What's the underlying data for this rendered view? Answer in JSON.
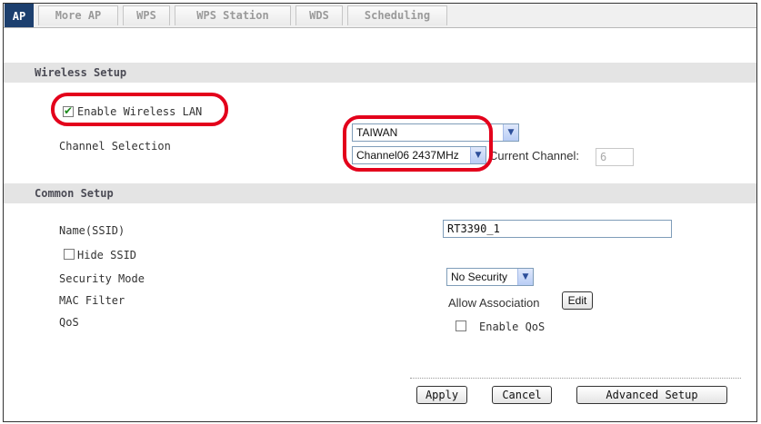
{
  "tabs": [
    {
      "label": "AP",
      "active": true
    },
    {
      "label": "More AP",
      "active": false
    },
    {
      "label": "WPS",
      "active": false
    },
    {
      "label": "WPS Station",
      "active": false
    },
    {
      "label": "WDS",
      "active": false
    },
    {
      "label": "Scheduling",
      "active": false
    }
  ],
  "wireless_setup": {
    "header": "Wireless Setup",
    "enable_wireless_label": "Enable Wireless LAN",
    "enable_wireless_checked": true,
    "channel_selection_label": "Channel Selection",
    "region_value": "TAIWAN",
    "channel_value": "Channel06 2437MHz",
    "current_channel_label": "Current Channel:",
    "current_channel_value": "6"
  },
  "common_setup": {
    "header": "Common Setup",
    "ssid_label": "Name(SSID)",
    "ssid_value": "RT3390_1",
    "hide_ssid_label": "Hide SSID",
    "hide_ssid_checked": false,
    "security_mode_label": "Security Mode",
    "security_mode_value": "No Security",
    "mac_filter_label": "MAC Filter",
    "mac_filter_value": "Allow Association",
    "edit_label": "Edit",
    "qos_label": "QoS",
    "enable_qos_label": "Enable QoS",
    "enable_qos_checked": false
  },
  "actions": {
    "apply_label": "Apply",
    "cancel_label": "Cancel",
    "advanced_label": "Advanced Setup"
  },
  "colors": {
    "highlight": "#e3001b",
    "active_tab": "#1c3f6e",
    "section_header_bg": "#e4e4e4"
  }
}
